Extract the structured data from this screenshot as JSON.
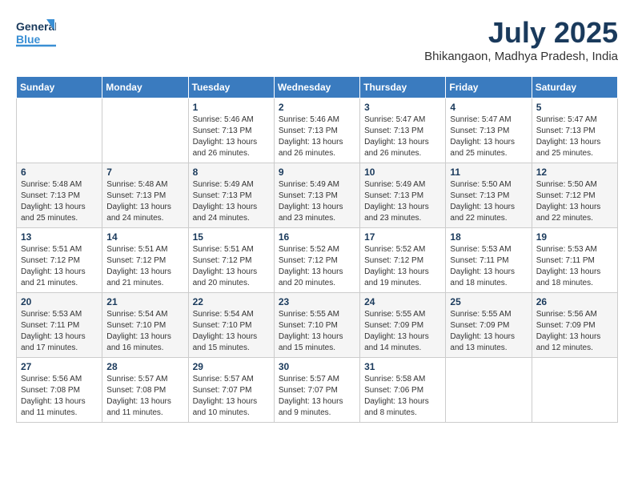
{
  "header": {
    "logo_general": "General",
    "logo_blue": "Blue",
    "month_year": "July 2025",
    "location": "Bhikangaon, Madhya Pradesh, India"
  },
  "weekdays": [
    "Sunday",
    "Monday",
    "Tuesday",
    "Wednesday",
    "Thursday",
    "Friday",
    "Saturday"
  ],
  "weeks": [
    [
      {
        "day": "",
        "info": ""
      },
      {
        "day": "",
        "info": ""
      },
      {
        "day": "1",
        "info": "Sunrise: 5:46 AM\nSunset: 7:13 PM\nDaylight: 13 hours and 26 minutes."
      },
      {
        "day": "2",
        "info": "Sunrise: 5:46 AM\nSunset: 7:13 PM\nDaylight: 13 hours and 26 minutes."
      },
      {
        "day": "3",
        "info": "Sunrise: 5:47 AM\nSunset: 7:13 PM\nDaylight: 13 hours and 26 minutes."
      },
      {
        "day": "4",
        "info": "Sunrise: 5:47 AM\nSunset: 7:13 PM\nDaylight: 13 hours and 25 minutes."
      },
      {
        "day": "5",
        "info": "Sunrise: 5:47 AM\nSunset: 7:13 PM\nDaylight: 13 hours and 25 minutes."
      }
    ],
    [
      {
        "day": "6",
        "info": "Sunrise: 5:48 AM\nSunset: 7:13 PM\nDaylight: 13 hours and 25 minutes."
      },
      {
        "day": "7",
        "info": "Sunrise: 5:48 AM\nSunset: 7:13 PM\nDaylight: 13 hours and 24 minutes."
      },
      {
        "day": "8",
        "info": "Sunrise: 5:49 AM\nSunset: 7:13 PM\nDaylight: 13 hours and 24 minutes."
      },
      {
        "day": "9",
        "info": "Sunrise: 5:49 AM\nSunset: 7:13 PM\nDaylight: 13 hours and 23 minutes."
      },
      {
        "day": "10",
        "info": "Sunrise: 5:49 AM\nSunset: 7:13 PM\nDaylight: 13 hours and 23 minutes."
      },
      {
        "day": "11",
        "info": "Sunrise: 5:50 AM\nSunset: 7:13 PM\nDaylight: 13 hours and 22 minutes."
      },
      {
        "day": "12",
        "info": "Sunrise: 5:50 AM\nSunset: 7:12 PM\nDaylight: 13 hours and 22 minutes."
      }
    ],
    [
      {
        "day": "13",
        "info": "Sunrise: 5:51 AM\nSunset: 7:12 PM\nDaylight: 13 hours and 21 minutes."
      },
      {
        "day": "14",
        "info": "Sunrise: 5:51 AM\nSunset: 7:12 PM\nDaylight: 13 hours and 21 minutes."
      },
      {
        "day": "15",
        "info": "Sunrise: 5:51 AM\nSunset: 7:12 PM\nDaylight: 13 hours and 20 minutes."
      },
      {
        "day": "16",
        "info": "Sunrise: 5:52 AM\nSunset: 7:12 PM\nDaylight: 13 hours and 20 minutes."
      },
      {
        "day": "17",
        "info": "Sunrise: 5:52 AM\nSunset: 7:12 PM\nDaylight: 13 hours and 19 minutes."
      },
      {
        "day": "18",
        "info": "Sunrise: 5:53 AM\nSunset: 7:11 PM\nDaylight: 13 hours and 18 minutes."
      },
      {
        "day": "19",
        "info": "Sunrise: 5:53 AM\nSunset: 7:11 PM\nDaylight: 13 hours and 18 minutes."
      }
    ],
    [
      {
        "day": "20",
        "info": "Sunrise: 5:53 AM\nSunset: 7:11 PM\nDaylight: 13 hours and 17 minutes."
      },
      {
        "day": "21",
        "info": "Sunrise: 5:54 AM\nSunset: 7:10 PM\nDaylight: 13 hours and 16 minutes."
      },
      {
        "day": "22",
        "info": "Sunrise: 5:54 AM\nSunset: 7:10 PM\nDaylight: 13 hours and 15 minutes."
      },
      {
        "day": "23",
        "info": "Sunrise: 5:55 AM\nSunset: 7:10 PM\nDaylight: 13 hours and 15 minutes."
      },
      {
        "day": "24",
        "info": "Sunrise: 5:55 AM\nSunset: 7:09 PM\nDaylight: 13 hours and 14 minutes."
      },
      {
        "day": "25",
        "info": "Sunrise: 5:55 AM\nSunset: 7:09 PM\nDaylight: 13 hours and 13 minutes."
      },
      {
        "day": "26",
        "info": "Sunrise: 5:56 AM\nSunset: 7:09 PM\nDaylight: 13 hours and 12 minutes."
      }
    ],
    [
      {
        "day": "27",
        "info": "Sunrise: 5:56 AM\nSunset: 7:08 PM\nDaylight: 13 hours and 11 minutes."
      },
      {
        "day": "28",
        "info": "Sunrise: 5:57 AM\nSunset: 7:08 PM\nDaylight: 13 hours and 11 minutes."
      },
      {
        "day": "29",
        "info": "Sunrise: 5:57 AM\nSunset: 7:07 PM\nDaylight: 13 hours and 10 minutes."
      },
      {
        "day": "30",
        "info": "Sunrise: 5:57 AM\nSunset: 7:07 PM\nDaylight: 13 hours and 9 minutes."
      },
      {
        "day": "31",
        "info": "Sunrise: 5:58 AM\nSunset: 7:06 PM\nDaylight: 13 hours and 8 minutes."
      },
      {
        "day": "",
        "info": ""
      },
      {
        "day": "",
        "info": ""
      }
    ]
  ]
}
